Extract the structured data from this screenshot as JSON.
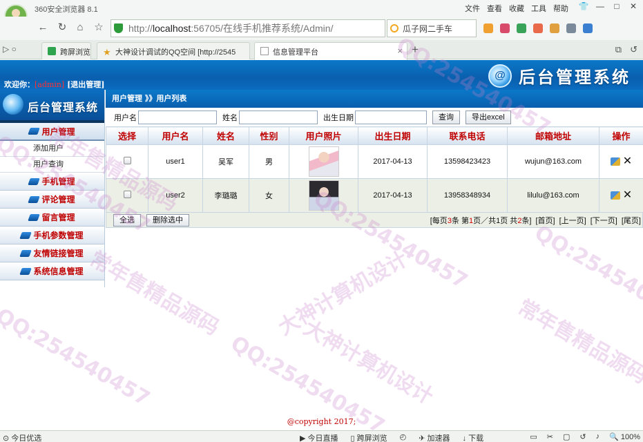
{
  "browser": {
    "app_title": "360安全浏览器 8.1",
    "menu": [
      "文件",
      "查看",
      "收藏",
      "工具",
      "帮助"
    ],
    "window_controls": [
      "👕",
      "—",
      "□",
      "✕"
    ],
    "url_prefix": "http://",
    "url_host": "localhost",
    "url_rest": ":56705/在线手机推荐系统/Admin/",
    "search_text": "瓜子网二手车",
    "tabs": [
      {
        "label": "跨屏浏览"
      },
      {
        "label": "大神设计调试的QQ空间 [http://2545"
      },
      {
        "label": "信息管理平台"
      }
    ]
  },
  "header": {
    "welcome_label": "欢迎你：",
    "username": "[admin]",
    "logout_label": "[退出管理]",
    "brand_title": "后台管理系统",
    "logo_text": "@"
  },
  "sidebar": {
    "title": "后台管理系统",
    "groups": [
      {
        "label": "用户管理"
      },
      {
        "label": "手机管理"
      },
      {
        "label": "评论管理"
      },
      {
        "label": "留言管理"
      },
      {
        "label": "手机参数管理"
      },
      {
        "label": "友情链接管理"
      },
      {
        "label": "系统信息管理"
      }
    ],
    "subitems": [
      {
        "label": "添加用户"
      },
      {
        "label": "用户查询"
      }
    ]
  },
  "content": {
    "breadcrumb": "用户管理 》》用户列表",
    "filters": {
      "username_label": "用户名",
      "name_label": "姓名",
      "birth_label": "出生日期",
      "query_button": "查询",
      "export_button": "导出excel"
    },
    "table": {
      "headers": [
        "选择",
        "用户名",
        "姓名",
        "性别",
        "用户照片",
        "出生日期",
        "联系电话",
        "邮箱地址",
        "操作"
      ],
      "rows": [
        {
          "username": "user1",
          "name": "吴军",
          "gender": "男",
          "birth": "2017-04-13",
          "phone": "13598423423",
          "email": "wujun@163.com"
        },
        {
          "username": "user2",
          "name": "李璐璐",
          "gender": "女",
          "birth": "2017-04-13",
          "phone": "13958348934",
          "email": "lilulu@163.com"
        }
      ]
    },
    "bottom": {
      "select_all": "全选",
      "delete_selected": "删除选中",
      "pager_a": "[每页",
      "per_page": "3",
      "pager_b": "条 第",
      "current_page": "1",
      "pager_c": "页／共",
      "total_pages": "1",
      "pager_d": "页 共",
      "total_items": "2",
      "pager_e": "条]",
      "first": "[首页]",
      "prev": "[上一页]",
      "next": "[下一页]",
      "last": "[尾页]"
    }
  },
  "footer": {
    "copyright": "@copyright 2017;"
  },
  "statusbar": {
    "left": "今日优选",
    "live": "今日直播",
    "cross_screen": "跨屏浏览",
    "accelerator": "加速器",
    "download": "下载",
    "zoom": "100%"
  },
  "watermarks": [
    "QQ:254540457",
    "大神计算机设计",
    "常年售精品源码"
  ],
  "colors": {
    "header_blue": "#0a5fae",
    "menu_red": "#c00000",
    "accent_red": "#ff3030"
  }
}
